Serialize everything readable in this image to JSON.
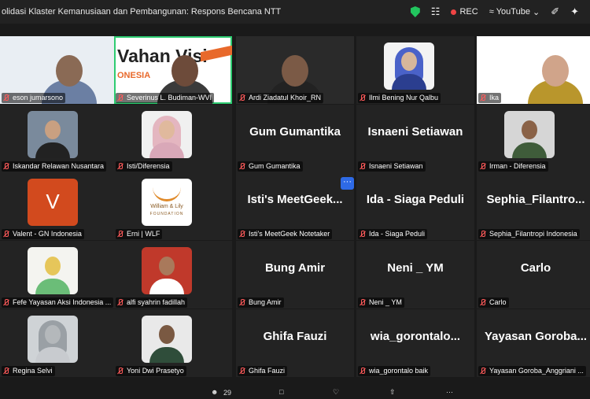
{
  "meeting": {
    "title": "olidasi Klaster Kemanusiaan dan Pembangunan: Respons Bencana NTT",
    "rec_label": "REC",
    "stream_label": "YouTube",
    "participants_count": "29",
    "more_label": "···"
  },
  "tiles": [
    {
      "name": "eson jumarsono",
      "big": ""
    },
    {
      "name": "Severinus L. Budiman-WVI",
      "big": "",
      "logo": "Vahan Visi",
      "logo2": "ONESIA"
    },
    {
      "name": "Ardi Ziadatul Khoir_RN",
      "big": ""
    },
    {
      "name": "Ilmi Bening Nur Qalbu",
      "big": ""
    },
    {
      "name": "Ika",
      "big": ""
    },
    {
      "name": "Iskandar Relawan Nusantara",
      "big": ""
    },
    {
      "name": "Isti/Diferensia",
      "big": ""
    },
    {
      "name": "Gum Gumantika",
      "big": "Gum Gumantika"
    },
    {
      "name": "Isnaeni Setiawan",
      "big": "Isnaeni Setiawan"
    },
    {
      "name": "Irman - Diferensia",
      "big": ""
    },
    {
      "name": "Valent - GN Indonesia",
      "big": "",
      "letter": "V"
    },
    {
      "name": "Erni | WLF",
      "big": "",
      "logo": "William & Lily",
      "logo2": "FOUNDATION"
    },
    {
      "name": "Isti's MeetGeek Notetaker",
      "big": "Isti's  MeetGeek..."
    },
    {
      "name": "Ida - Siaga Peduli",
      "big": "Ida - Siaga Peduli"
    },
    {
      "name": "Sephia_Filantropi Indonesia",
      "big": "Sephia_Filantro..."
    },
    {
      "name": "Fefe Yayasan Aksi Indonesia ...",
      "big": ""
    },
    {
      "name": "alfi syahrin fadillah",
      "big": ""
    },
    {
      "name": "Bung Amir",
      "big": "Bung Amir"
    },
    {
      "name": "Neni _ YM",
      "big": "Neni _ YM"
    },
    {
      "name": "Carlo",
      "big": "Carlo"
    },
    {
      "name": "Regina Selvi",
      "big": ""
    },
    {
      "name": "Yoni Dwi Prasetyo",
      "big": ""
    },
    {
      "name": "Ghifa Fauzi",
      "big": "Ghifa Fauzi"
    },
    {
      "name": "wia_gorontalo baik",
      "big": "wia_gorontalo..."
    },
    {
      "name": "Yayasan Goroba_Anggriani ...",
      "big": "Yayasan  Goroba..."
    }
  ]
}
